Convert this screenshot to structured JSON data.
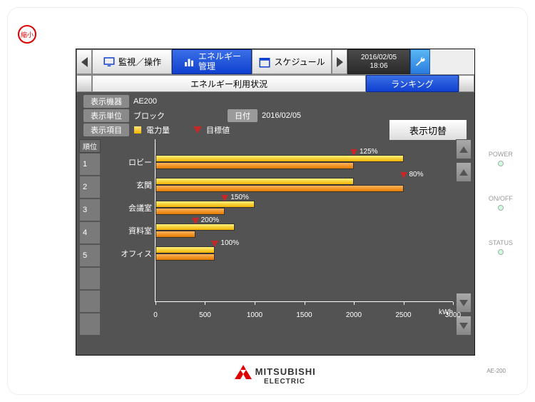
{
  "shrink_label": "縮小",
  "side": {
    "power": "POWER",
    "onoff": "ON/OFF",
    "status": "STATUS"
  },
  "model": "AE-200",
  "topnav": {
    "monitor": "監視／操作",
    "energy_l1": "エネルギー",
    "energy_l2": "管理",
    "schedule": "スケジュール",
    "date": "2016/02/05",
    "time": "18:06"
  },
  "subnav": {
    "usage": "エネルギー利用状況",
    "ranking": "ランキング"
  },
  "info": {
    "device_label": "表示機器",
    "device_value": "AE200",
    "unit_label": "表示単位",
    "unit_value": "ブロック",
    "date_label": "日付",
    "date_value": "2016/02/05",
    "item_label": "表示項目",
    "item_power": "電力量",
    "item_target": "目標値",
    "toggle": "表示切替"
  },
  "rank_header": "順位",
  "axis_unit": "kWh",
  "chart_data": {
    "type": "bar",
    "title": "ランキング",
    "xlabel": "",
    "ylabel": "kWh",
    "xlim": [
      0,
      3000
    ],
    "ticks": [
      0,
      500,
      1000,
      1500,
      2000,
      2500,
      3000
    ],
    "series": [
      {
        "name": "電力量",
        "values": [
          2500,
          2000,
          1000,
          800,
          600
        ]
      },
      {
        "name": "目標値",
        "values": [
          2000,
          2500,
          700,
          400,
          600
        ]
      }
    ],
    "categories": [
      "ロビー",
      "玄関",
      "会議室",
      "資料室",
      "オフィス"
    ],
    "ranks": [
      "1",
      "2",
      "3",
      "4",
      "5"
    ],
    "percent_labels": [
      "125%",
      "80%",
      "150%",
      "200%",
      "100%"
    ]
  },
  "logo": {
    "l1": "MITSUBISHI",
    "l2": "ELECTRIC"
  }
}
